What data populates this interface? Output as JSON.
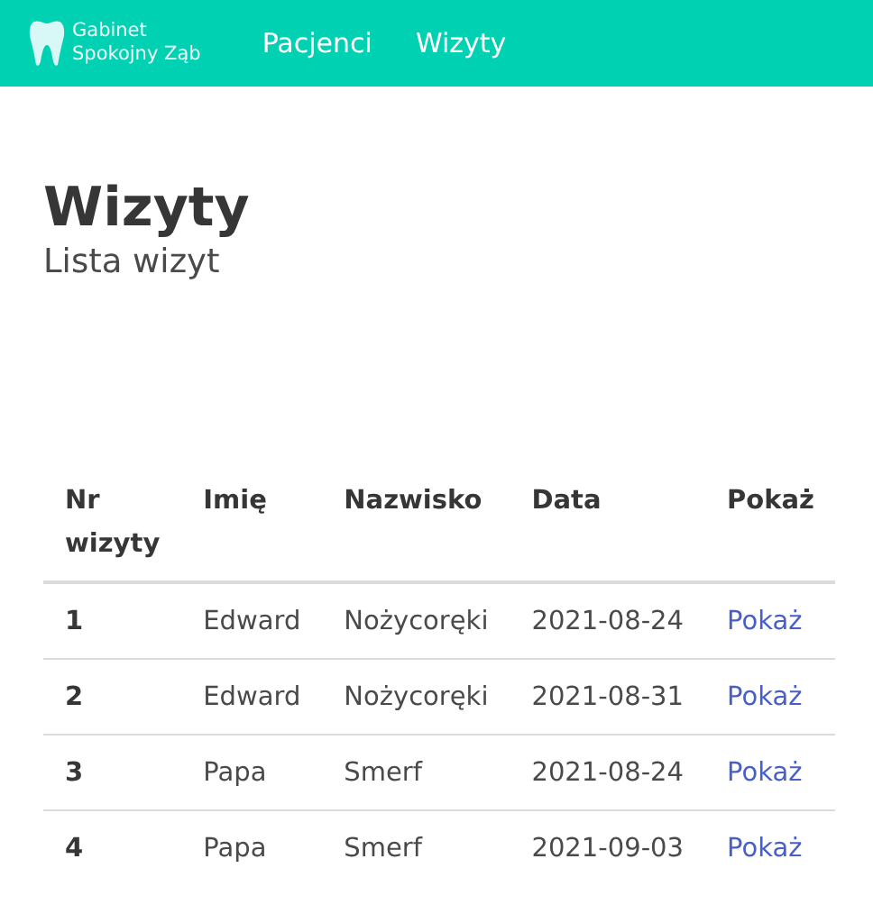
{
  "navbar": {
    "brand": [
      "Gabinet",
      "Spokojny Ząb"
    ],
    "links": [
      "Pacjenci",
      "Wizyty"
    ]
  },
  "page": {
    "title": "Wizyty",
    "subtitle": "Lista wizyt"
  },
  "table": {
    "columns": [
      "Nr wizyty",
      "Imię",
      "Nazwisko",
      "Data",
      "Pokaż"
    ],
    "rows": [
      {
        "nr": "1",
        "first_name": "Edward",
        "last_name": "Nożycoręki",
        "date": "2021-08-24",
        "link": "Pokaż"
      },
      {
        "nr": "2",
        "first_name": "Edward",
        "last_name": "Nożycoręki",
        "date": "2021-08-31",
        "link": "Pokaż"
      },
      {
        "nr": "3",
        "first_name": "Papa",
        "last_name": "Smerf",
        "date": "2021-08-24",
        "link": "Pokaż"
      },
      {
        "nr": "4",
        "first_name": "Papa",
        "last_name": "Smerf",
        "date": "2021-09-03",
        "link": "Pokaż"
      }
    ]
  }
}
